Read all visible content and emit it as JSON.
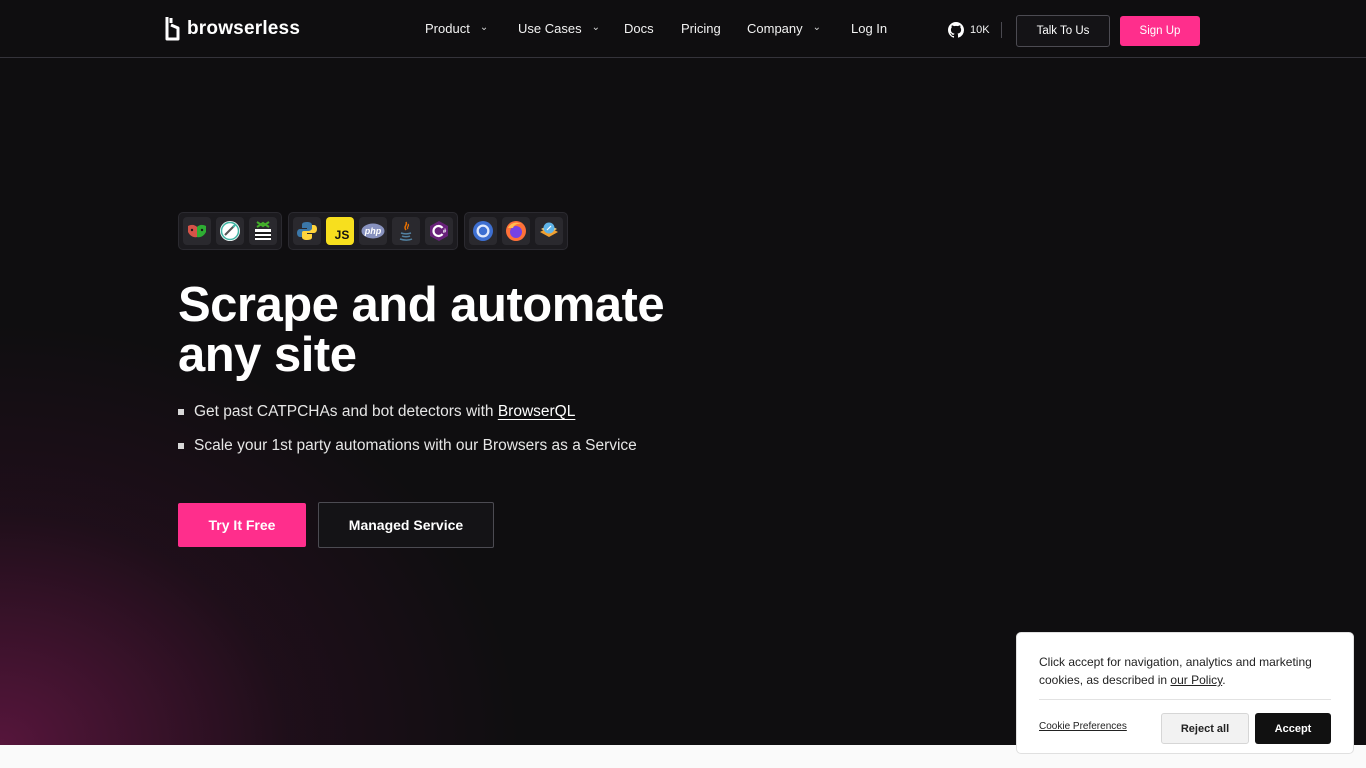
{
  "header": {
    "logo_text": "browserless",
    "nav": [
      {
        "label": "Product",
        "has_dropdown": true
      },
      {
        "label": "Use Cases",
        "has_dropdown": true
      },
      {
        "label": "Docs",
        "has_dropdown": false
      },
      {
        "label": "Pricing",
        "has_dropdown": false
      },
      {
        "label": "Company",
        "has_dropdown": true
      },
      {
        "label": "Log In",
        "has_dropdown": false
      }
    ],
    "github_stars": "10K",
    "talk_label": "Talk To Us",
    "signup_label": "Sign Up"
  },
  "hero": {
    "icon_groups": [
      [
        "playwright-icon",
        "puppeteer-icon",
        "selenium-icon"
      ],
      [
        "python-icon",
        "javascript-icon",
        "php-icon",
        "java-icon",
        "csharp-icon"
      ],
      [
        "chrome-icon",
        "firefox-icon",
        "webkit-icon"
      ]
    ],
    "title_line1": "Scrape and automate",
    "title_line2": "any site",
    "bullet1_text": "Get past CATPCHAs and bot detectors with",
    "bullet1_link": "BrowserQL",
    "bullet2_text": "Scale your 1st party automations with our Browsers as a Service",
    "try_label": "Try It Free",
    "managed_label": "Managed Service"
  },
  "cookie": {
    "text_before": "Click accept for navigation, analytics and marketing cookies, as described in",
    "policy_link": "our Policy",
    "text_after": ".",
    "preferences_label": "Cookie Preferences",
    "reject_label": "Reject all",
    "accept_label": "Accept"
  },
  "colors": {
    "accent": "#ff2e8c",
    "background": "#0f0e10",
    "hero_glow": "#6e184a"
  }
}
